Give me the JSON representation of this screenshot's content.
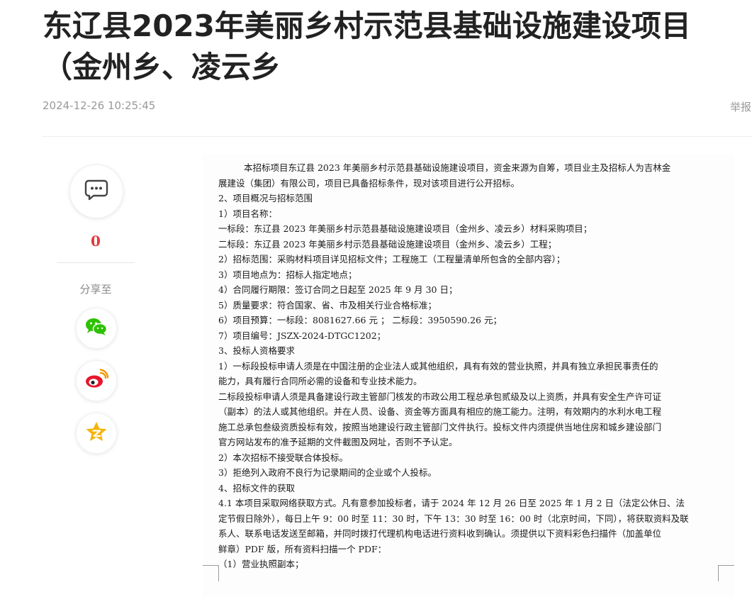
{
  "article": {
    "title": "东辽县2023年美丽乡村示范县基础设施建设项目（金州乡、凌云乡",
    "publish_time": "2024-12-26 10:25:45",
    "report_label": "举报"
  },
  "actions": {
    "comment_count": "0",
    "share_label": "分享至",
    "icons": {
      "comment": "comment-icon",
      "wechat": "wechat-icon",
      "weibo": "weibo-icon",
      "qzone": "qzone-icon"
    }
  },
  "colors": {
    "accent_red": "#e4393c",
    "wechat_green": "#2dc100",
    "weibo_red": "#e6162d",
    "qzone_yellow": "#f5b40a"
  },
  "document": {
    "lines": [
      "本招标项目东辽县 2023 年美丽乡村示范县基础设施建设项目，资金来源为自筹，项目业主及招标人为吉林金",
      "展建设（集团）有限公司，项目已具备招标条件，现对该项目进行公开招标。",
      "2、项目概况与招标范围",
      "1）项目名称：",
      "一标段：东辽县 2023 年美丽乡村示范县基础设施建设项目（金州乡、凌云乡）材料采购项目；",
      "二标段：东辽县 2023 年美丽乡村示范县基础设施建设项目（金州乡、凌云乡）工程；",
      "2）招标范围：采购材料项目详见招标文件；工程施工（工程量清单所包含的全部内容）；",
      "3）项目地点为：招标人指定地点；",
      "4）合同履行期限：签订合同之日起至 2025 年 9 月 30 日；",
      "5）质量要求：符合国家、省、市及相关行业合格标准；",
      "6）项目预算：一标段：8081627.66 元 ； 二标段：3950590.26 元；",
      "7）项目编号：JSZX-2024-DTGC1202；",
      "3、投标人资格要求",
      "1）一标段投标申请人须是在中国注册的企业法人或其他组织，具有有效的营业执照，并具有独立承担民事责任的",
      "能力，具有履行合同所必需的设备和专业技术能力。",
      "二标段投标申请人须是具备建设行政主管部门核发的市政公用工程总承包贰级及以上资质，并具有安全生产许可证",
      "（副本）的法人或其他组织。并在人员、设备、资金等方面具有相应的施工能力。注明，有效期内的水利水电工程",
      "施工总承包叁级资质投标有效，按照当地建设行政主管部门文件执行。投标文件内须提供当地住房和城乡建设部门",
      "官方网站发布的准予延期的文件截图及网址，否则不予认定。",
      "2）本次招标不接受联合体投标。",
      "3）拒绝列入政府不良行为记录期间的企业或个人投标。",
      "4、招标文件的获取",
      "4.1 本项目采取网络获取方式。凡有意参加投标者，请于 2024 年 12 月 26 日至 2025 年 1 月 2 日（法定公休日、法",
      "定节假日除外），每日上午 9：00 时至 11：30 时，下午 13：30 时至 16：00 时（北京时间，下同），将获取资料及联",
      "系人、联系电话发送至邮箱，并同时拨打代理机构电话进行资料收到确认。须提供以下资料彩色扫描件（加盖单位",
      "鲜章）PDF 版，所有资料扫描一个 PDF：",
      "（1）营业执照副本；"
    ]
  }
}
